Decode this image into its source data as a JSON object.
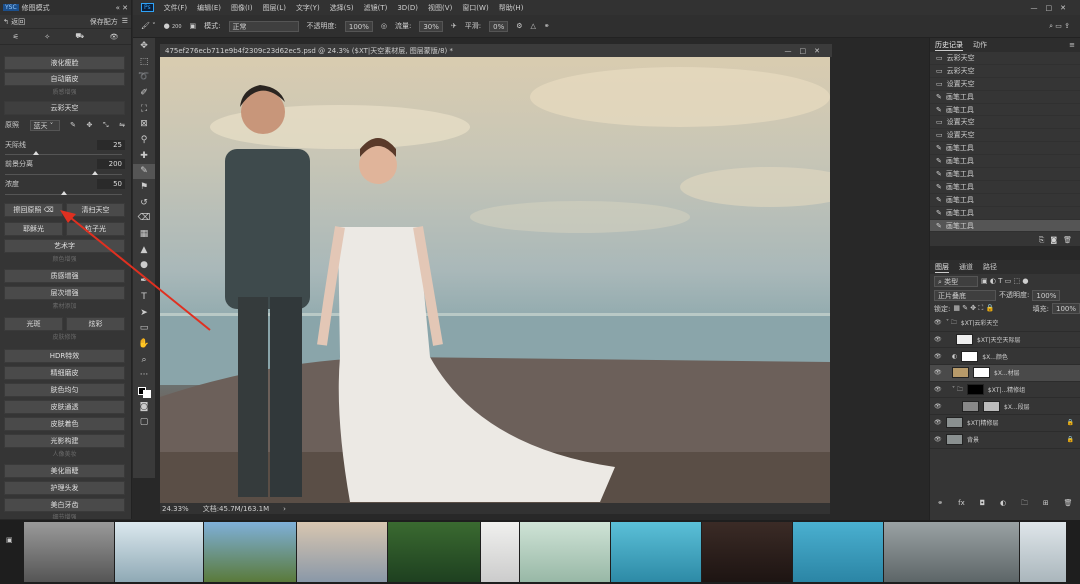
{
  "plugin": {
    "mode_badge": "YSC",
    "title": "修图模式",
    "back": "返回",
    "save_preset": "保存配方",
    "btn_liquify": "液化瘦脸",
    "btn_auto_skin": "自动磨皮",
    "sec_skin": "质感增强",
    "sec_sky": "云彩天空",
    "src_label": "原照",
    "src_value": "蓝天",
    "slider_sky": {
      "label": "天际线",
      "value": "25",
      "frac": 0.25
    },
    "slider_fg": {
      "label": "前景分离",
      "value": "200",
      "frac": 0.78
    },
    "slider_density": {
      "label": "浓度",
      "value": "50",
      "frac": 0.5
    },
    "btn_restore": "擦回原照",
    "btn_clear_sky": "清扫天空",
    "btn_glow": "耶稣光",
    "btn_particle": "粒子光",
    "btn_art": "艺术字",
    "sec_color": "颜色增强",
    "btn_texture": "质感增强",
    "btn_layer": "层次增强",
    "sec_material": "素材添加",
    "btn_spot": "光斑",
    "btn_glare": "炫彩",
    "sec_skin2": "皮肤修饰",
    "btn_hdr": "HDR特效",
    "btn_fine_skin": "精细磨皮",
    "btn_even": "肤色均匀",
    "btn_pass": "皮肤通透",
    "btn_tone": "皮肤着色",
    "btn_light": "光影构建",
    "sec_portrait": "人像美妆",
    "btn_eyebrow": "美化眉睫",
    "btn_hair": "护理头发",
    "btn_teeth": "美白牙齿",
    "sec_last": "细节增强"
  },
  "menu": [
    "Ps",
    "文件(F)",
    "编辑(E)",
    "图像(I)",
    "图层(L)",
    "文字(Y)",
    "选择(S)",
    "滤镜(T)",
    "3D(D)",
    "视图(V)",
    "窗口(W)",
    "帮助(H)"
  ],
  "options": {
    "mode_label": "模式:",
    "mode_value": "正常",
    "opacity_label": "不透明度:",
    "opacity_value": "100%",
    "flow_label": "流量:",
    "flow_value": "30%",
    "smooth_label": "平滑:",
    "smooth_value": "0%",
    "brush_size": "200"
  },
  "doc": {
    "tab": "475ef276ecb711e9b4f2309c23d62ec5.psd @ 24.3% ($XT|天空素材层, 图层蒙版/8) *",
    "zoom": "24.33%",
    "docsize": "文档:45.7M/163.1M"
  },
  "history": {
    "tabs": [
      "历史记录",
      "动作"
    ],
    "items": [
      "云彩天空",
      "云彩天空",
      "设置天空",
      "画笔工具",
      "画笔工具",
      "设置天空",
      "设置天空",
      "画笔工具",
      "画笔工具",
      "画笔工具",
      "画笔工具",
      "画笔工具",
      "画笔工具",
      "画笔工具"
    ]
  },
  "layers": {
    "tabs": [
      "图层",
      "通道",
      "路径"
    ],
    "kind": "类型",
    "blend": "正片叠底",
    "opacity_label": "不透明度:",
    "opacity": "100%",
    "lock_label": "锁定:",
    "fill_label": "填充:",
    "fill": "100%",
    "items": [
      "$XT|云彩天空",
      "$XT|天空天际层",
      "$X...颜色",
      "$X...材层",
      "$XT|...精修组",
      "$X...段层",
      "$XT|精修层",
      "背景"
    ]
  },
  "colors": {
    "accent": "#2fa3f7",
    "arrow": "#e03020"
  }
}
